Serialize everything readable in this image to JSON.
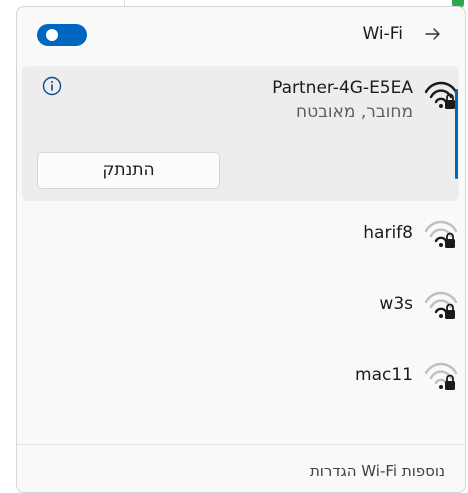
{
  "header": {
    "wifi_label": "Wi-Fi"
  },
  "connected_network": {
    "name": "Partner-4G-E5EA",
    "status": "מחובר, מאובטח",
    "disconnect_label": "התנתק"
  },
  "networks": [
    {
      "name": "harif8"
    },
    {
      "name": "w3s"
    },
    {
      "name": "mac11"
    }
  ],
  "footer": {
    "more_settings": "הגדרות Wi-Fi נוספות"
  },
  "colors": {
    "accent": "#0067c0"
  },
  "icons": [
    "toggle",
    "arrow-right-icon",
    "info-icon",
    "wifi-secured-icon"
  ]
}
